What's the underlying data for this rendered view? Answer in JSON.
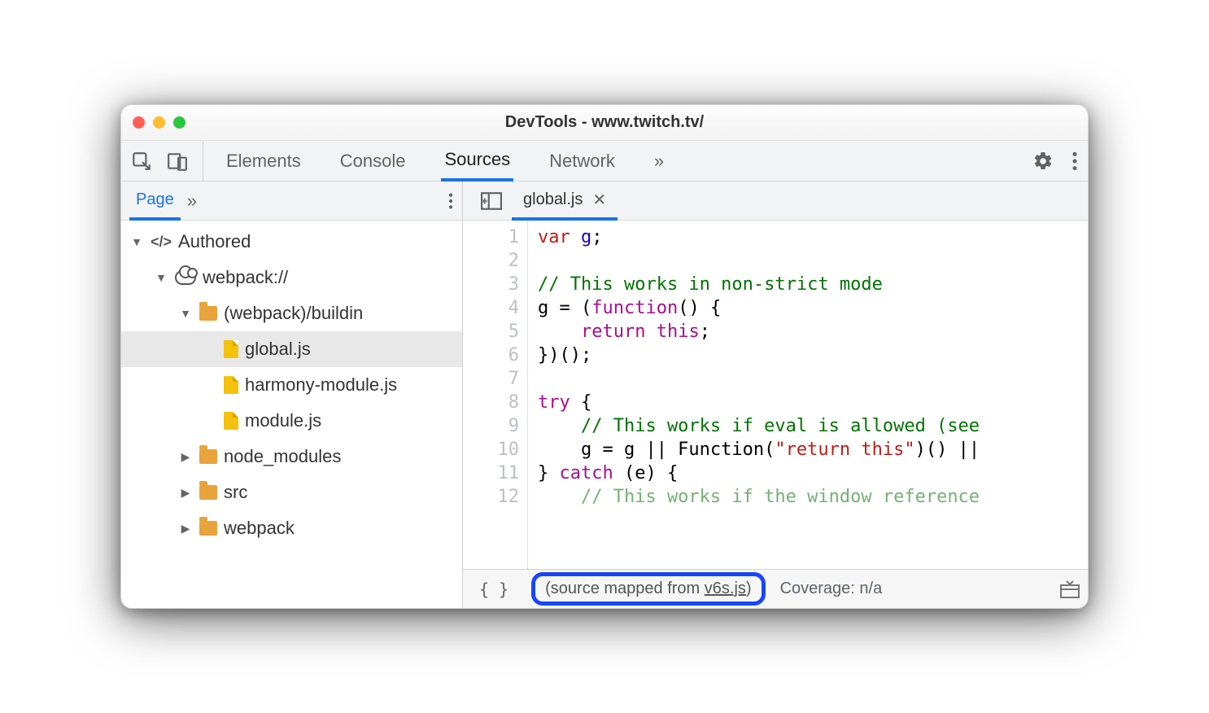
{
  "window": {
    "title": "DevTools - www.twitch.tv/"
  },
  "topTabs": {
    "items": [
      "Elements",
      "Console",
      "Sources",
      "Network"
    ],
    "active": "Sources",
    "more": "»"
  },
  "sidebar": {
    "tabs": {
      "active": "Page",
      "more": "»"
    },
    "tree": {
      "root": "Authored",
      "cloud": "webpack://",
      "buildin": {
        "label": "(webpack)/buildin",
        "files": [
          "global.js",
          "harmony-module.js",
          "module.js"
        ],
        "selected": "global.js"
      },
      "folders": [
        "node_modules",
        "src",
        "webpack"
      ]
    }
  },
  "editor": {
    "openTab": "global.js",
    "gutterStart": 1,
    "gutterEnd": 12,
    "source": {
      "l1_var": "var ",
      "l1_g": "g",
      "l1_end": ";",
      "l3_cm": "// This works in non-strict mode",
      "l4_a": "g = (",
      "l4_fn": "function",
      "l4_b": "() {",
      "l5_a": "    ",
      "l5_ret": "return ",
      "l5_this": "this",
      "l5_b": ";",
      "l6": "})();",
      "l8_try": "try",
      "l8_b": " {",
      "l9_cm": "    // This works if eval is allowed (see",
      "l10_a": "    g = g || Function(",
      "l10_str": "\"return this\"",
      "l10_b": ")() ||",
      "l11_a": "} ",
      "l11_catch": "catch",
      "l11_b": " (e) {",
      "l12_cm": "    // This works if the window reference"
    }
  },
  "footer": {
    "prettyPrint": "{ }",
    "mapped_prefix": "(source mapped from ",
    "mapped_src": "v6s.js",
    "mapped_suffix": ")",
    "coverage": "Coverage: n/a"
  }
}
